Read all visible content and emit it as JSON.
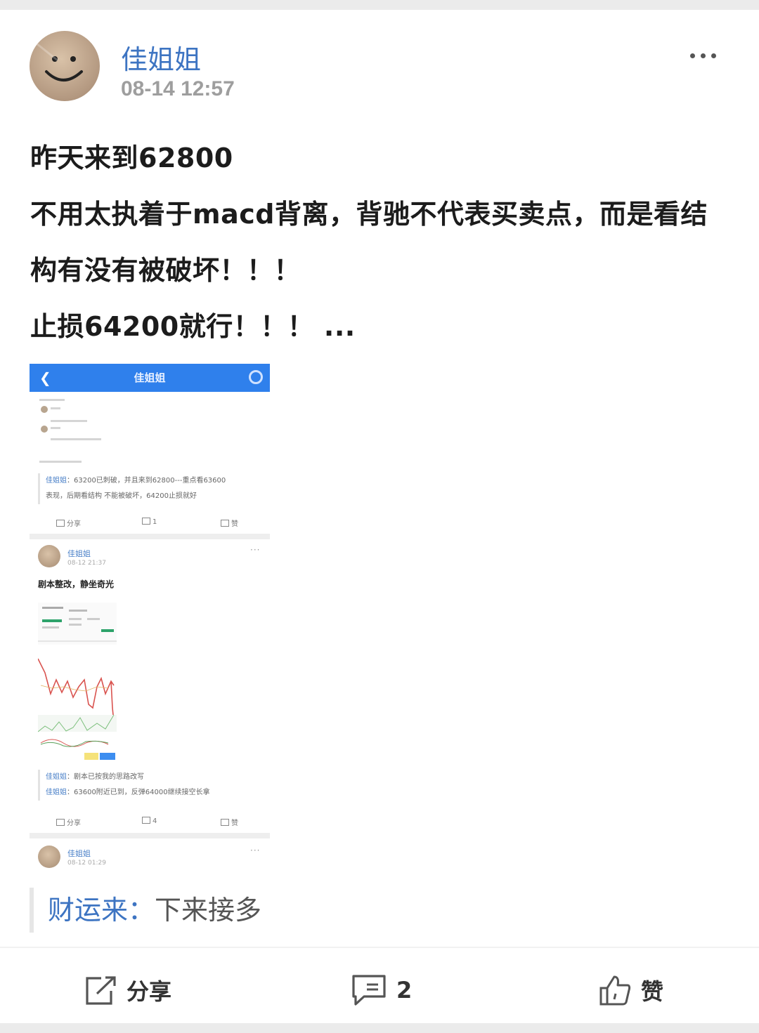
{
  "post": {
    "author": "佳姐姐",
    "time": "08-14 12:57",
    "lines": [
      "昨天来到62800",
      "不用太执着于macd背离，背驰不代表买卖点，而是看结",
      "构有没有被破坏！！！",
      "止损64200就行！！！ ..."
    ]
  },
  "screenshot": {
    "header_title": "佳姐姐",
    "post1": {
      "reply_user": "佳姐姐",
      "reply_sep": "：",
      "reply_line1": "63200已刺破，并且来到62800---重点看63600",
      "reply_line2": "表现，后期看结构  不能被破坏，64200止损就好",
      "share": "分享",
      "comments": "1",
      "like": "赞"
    },
    "post2": {
      "author": "佳姐姐",
      "time": "08-12 21:37",
      "text": "剧本整改，静坐奇光",
      "reply1_user": "佳姐姐",
      "reply1_text": "剧本已按我的思路改写",
      "reply2_user": "佳姐姐",
      "reply2_text": "63600附近已到，反弹64000继续接空长拿",
      "share": "分享",
      "comments": "4",
      "like": "赞"
    },
    "post3": {
      "author": "佳姐姐",
      "time": "08-12 01:29"
    }
  },
  "comment": {
    "user": "财运来",
    "separator": "：",
    "text": "下来接多"
  },
  "actions": {
    "share": "分享",
    "comments": "2",
    "like": "赞"
  },
  "colors": {
    "link_blue": "#3d74c2",
    "header_blue": "#2f80ec"
  }
}
